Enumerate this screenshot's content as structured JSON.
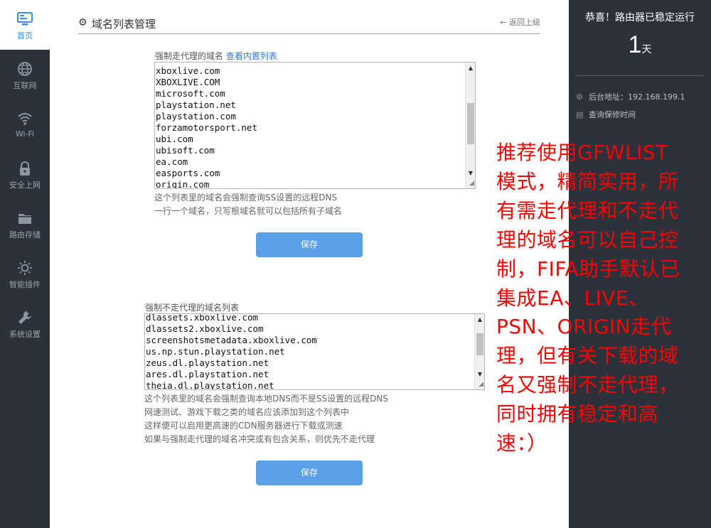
{
  "nav": {
    "items": [
      {
        "label": "首页",
        "icon": "monitor-icon"
      },
      {
        "label": "互联网",
        "icon": "globe-icon"
      },
      {
        "label": "Wi-Fi",
        "icon": "wifi-icon"
      },
      {
        "label": "安全上网",
        "icon": "lock-icon"
      },
      {
        "label": "路由存储",
        "icon": "folder-icon"
      },
      {
        "label": "智能插件",
        "icon": "bulb-icon"
      },
      {
        "label": "系统设置",
        "icon": "wrench-icon"
      }
    ]
  },
  "header": {
    "title": "域名列表管理",
    "back_label": "返回上级"
  },
  "proxy_section": {
    "label": "强制走代理的域名",
    "link": "查看内置列表",
    "lines": [
      "xboxlive.com",
      "XBOXLIVE.COM",
      "microsoft.com",
      "playstation.net",
      "playstation.com",
      "forzamotorsport.net",
      "ubi.com",
      "ubisoft.com",
      "ea.com",
      "easports.com",
      "origin.com"
    ],
    "notes": [
      "这个列表里的域名会强制查询SS设置的远程DNS",
      "一行一个域名，只写根域名就可以包括所有子域名"
    ],
    "save_label": "保存"
  },
  "direct_section": {
    "label": "强制不走代理的域名列表",
    "lines": [
      "dlassets.xboxlive.com",
      "dlassets2.xboxlive.com",
      "screenshotsmetadata.xboxlive.com",
      "us.np.stun.playstation.net",
      "zeus.dl.playstation.net",
      "ares.dl.playstation.net",
      "theia.dl.playstation.net"
    ],
    "notes": [
      "这个列表里的域名会强制查询本地DNS而不是SS设置的远程DNS",
      "网速测试、游戏下载之类的域名应该添加到这个列表中",
      "这样便可以启用更高速的CDN服务器进行下载或测速",
      "如果与强制走代理的域名冲突或有包含关系，则优先不走代理"
    ],
    "save_label": "保存"
  },
  "status": {
    "title": "恭喜！路由器已稳定运行",
    "days": "1",
    "days_unit": "天",
    "admin_address": "后台地址：192.168.199.1",
    "warranty": "查询保修时间"
  },
  "annotation": {
    "lines": [
      "推荐使用GFWLIST",
      "模式，精简实用，所",
      "有需走代理和不走代",
      "理的域名可以自己控",
      "制，FIFA助手默认已",
      "集成EA、LIVE、",
      "PSN、ORIGIN走代",
      "理，但有关下载的域",
      "名又强制不走代理，",
      "同时拥有稳定和高",
      "速：）"
    ],
    "color": "#ff0000"
  },
  "colors": {
    "nav_bg": "#2b323b",
    "accent": "#3a8ee6",
    "button": "#5aa0e8",
    "link": "#2d7be0"
  }
}
